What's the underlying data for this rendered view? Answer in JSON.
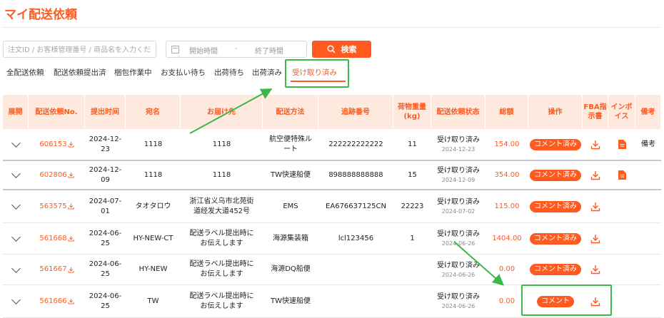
{
  "page": {
    "title": "マイ配送依頼"
  },
  "search": {
    "order_placeholder": "注文ID / お客様管理番号 / 商品名を入力ください",
    "start_time": "開始時間",
    "date_sep": "-",
    "end_time": "終了時間",
    "button_label": "検索"
  },
  "tabs": [
    {
      "label": "全配送依頼"
    },
    {
      "label": "配送依頼提出済"
    },
    {
      "label": "梱包作業中"
    },
    {
      "label": "お支払い待ち"
    },
    {
      "label": "出荷待ち"
    },
    {
      "label": "出荷済み"
    },
    {
      "label": "受け取り済み",
      "active": true
    }
  ],
  "table": {
    "headers": [
      "展開",
      "配送依頼No.",
      "提出时间",
      "宛名",
      "お届け先",
      "配送方法",
      "追跡番号",
      "荷物重量\n(kg)",
      "配送依頼状态",
      "総額",
      "操作",
      "FBA指\n示書",
      "インボ\nイス",
      "備考"
    ],
    "rows": [
      {
        "id": "606153",
        "date": "2024-12-23",
        "name": "1118",
        "address": "1118",
        "method": "航空便特殊ルート",
        "tracking": "222222222222",
        "weight": "11",
        "status": "受け取り済み",
        "status_date": "2024-12-23",
        "total": "154.00",
        "action": "コメント済み",
        "invoice": true,
        "note": "備考"
      },
      {
        "id": "602806",
        "date": "2024-12-09",
        "name": "1118",
        "address": "1118",
        "method": "TW快速船便",
        "tracking": "898888888888",
        "weight": "15",
        "status": "受け取り済み",
        "status_date": "2024-12-09",
        "total": "354.00",
        "action": "コメント済み",
        "invoice": true,
        "note": ""
      },
      {
        "id": "563575",
        "date": "2024-07-01",
        "name": "タオタロウ",
        "address": "浙江省义乌市北苑街道经发大道452号",
        "method": "EMS",
        "tracking": "EA676637125CN",
        "weight": "22223",
        "status": "受け取り済み",
        "status_date": "2024-07-02",
        "total": "115.00",
        "action": "コメント済み",
        "invoice": false,
        "note": ""
      },
      {
        "id": "561668",
        "date": "2024-06-25",
        "name": "HY-NEW-CT",
        "address": "配送ラベル提出時にお伝えします",
        "method": "海源集装箱",
        "tracking": "lcl123456",
        "weight": "1",
        "status": "受け取り済み",
        "status_date": "2024-06-26",
        "total": "1404.00",
        "action": "コメント済み",
        "invoice": false,
        "note": ""
      },
      {
        "id": "561667",
        "date": "2024-06-25",
        "name": "HY-NEW",
        "address": "配送ラベル提出時にお伝えします",
        "method": "海源DQ船便",
        "tracking": "",
        "weight": "",
        "status": "受け取り済み",
        "status_date": "2024-06-26",
        "total": "0.00",
        "action": "コメント済み",
        "invoice": false,
        "note": ""
      },
      {
        "id": "561666",
        "date": "2024-06-25",
        "name": "TW",
        "address": "配送ラベル提出時にお伝えします",
        "method": "TW快速船便",
        "tracking": "",
        "weight": "",
        "status": "受け取り済み",
        "status_date": "2024-06-26",
        "total": "0.00",
        "action": "コメント",
        "invoice": false,
        "note": ""
      }
    ]
  },
  "icons": {
    "search": "search-icon",
    "calendar": "calendar-icon",
    "expand": "chevron-down-icon",
    "download": "download-icon",
    "invoice": "document-icon"
  },
  "colors": {
    "accent": "#ff5a1f",
    "header_bg": "#fde9de",
    "highlight": "#3cb84a"
  }
}
